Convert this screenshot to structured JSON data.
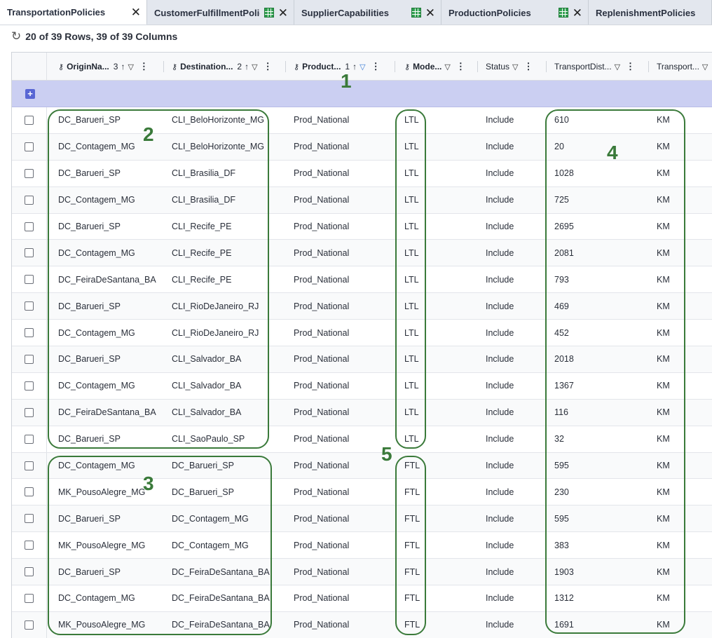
{
  "tabs": [
    {
      "label": "TransportationPolicies",
      "active": true,
      "has_icons": false
    },
    {
      "label": "CustomerFulfillmentPolicie",
      "active": false,
      "has_icons": true
    },
    {
      "label": "SupplierCapabilities",
      "active": false,
      "has_icons": true
    },
    {
      "label": "ProductionPolicies",
      "active": false,
      "has_icons": true
    },
    {
      "label": "ReplenishmentPolicies",
      "active": false,
      "has_icons": false
    }
  ],
  "row_summary": "20 of 39 Rows, 39 of 39 Columns",
  "columns": [
    {
      "label": "OriginNa...",
      "key": true,
      "sort": "3",
      "sort_arrow": "↑",
      "filter": "▽",
      "filter_active": false,
      "menu": "⋮",
      "bold": true
    },
    {
      "label": "Destination...",
      "key": true,
      "sort": "2",
      "sort_arrow": "↑",
      "filter": "▽",
      "filter_active": false,
      "menu": "⋮",
      "bold": true
    },
    {
      "label": "Product...",
      "key": true,
      "sort": "1",
      "sort_arrow": "↑",
      "filter": "▽",
      "filter_active": true,
      "menu": "⋮",
      "bold": true
    },
    {
      "label": "Mode...",
      "key": true,
      "sort": "",
      "sort_arrow": "",
      "filter": "▽",
      "filter_active": false,
      "menu": "⋮",
      "bold": true
    },
    {
      "label": "Status",
      "key": false,
      "sort": "",
      "sort_arrow": "",
      "filter": "▽",
      "filter_active": false,
      "menu": "⋮",
      "bold": false
    },
    {
      "label": "TransportDist...",
      "key": false,
      "sort": "",
      "sort_arrow": "",
      "filter": "▽",
      "filter_active": false,
      "menu": "⋮",
      "bold": false
    },
    {
      "label": "Transport...",
      "key": false,
      "sort": "",
      "sort_arrow": "",
      "filter": "▽",
      "filter_active": false,
      "menu": "",
      "bold": false
    }
  ],
  "rows": [
    [
      "DC_Barueri_SP",
      "CLI_BeloHorizonte_MG",
      "Prod_National",
      "LTL",
      "Include",
      "610",
      "KM"
    ],
    [
      "DC_Contagem_MG",
      "CLI_BeloHorizonte_MG",
      "Prod_National",
      "LTL",
      "Include",
      "20",
      "KM"
    ],
    [
      "DC_Barueri_SP",
      "CLI_Brasilia_DF",
      "Prod_National",
      "LTL",
      "Include",
      "1028",
      "KM"
    ],
    [
      "DC_Contagem_MG",
      "CLI_Brasilia_DF",
      "Prod_National",
      "LTL",
      "Include",
      "725",
      "KM"
    ],
    [
      "DC_Barueri_SP",
      "CLI_Recife_PE",
      "Prod_National",
      "LTL",
      "Include",
      "2695",
      "KM"
    ],
    [
      "DC_Contagem_MG",
      "CLI_Recife_PE",
      "Prod_National",
      "LTL",
      "Include",
      "2081",
      "KM"
    ],
    [
      "DC_FeiraDeSantana_BA",
      "CLI_Recife_PE",
      "Prod_National",
      "LTL",
      "Include",
      "793",
      "KM"
    ],
    [
      "DC_Barueri_SP",
      "CLI_RioDeJaneiro_RJ",
      "Prod_National",
      "LTL",
      "Include",
      "469",
      "KM"
    ],
    [
      "DC_Contagem_MG",
      "CLI_RioDeJaneiro_RJ",
      "Prod_National",
      "LTL",
      "Include",
      "452",
      "KM"
    ],
    [
      "DC_Barueri_SP",
      "CLI_Salvador_BA",
      "Prod_National",
      "LTL",
      "Include",
      "2018",
      "KM"
    ],
    [
      "DC_Contagem_MG",
      "CLI_Salvador_BA",
      "Prod_National",
      "LTL",
      "Include",
      "1367",
      "KM"
    ],
    [
      "DC_FeiraDeSantana_BA",
      "CLI_Salvador_BA",
      "Prod_National",
      "LTL",
      "Include",
      "116",
      "KM"
    ],
    [
      "DC_Barueri_SP",
      "CLI_SaoPaulo_SP",
      "Prod_National",
      "LTL",
      "Include",
      "32",
      "KM"
    ],
    [
      "DC_Contagem_MG",
      "DC_Barueri_SP",
      "Prod_National",
      "FTL",
      "Include",
      "595",
      "KM"
    ],
    [
      "MK_PousoAlegre_MG",
      "DC_Barueri_SP",
      "Prod_National",
      "FTL",
      "Include",
      "230",
      "KM"
    ],
    [
      "DC_Barueri_SP",
      "DC_Contagem_MG",
      "Prod_National",
      "FTL",
      "Include",
      "595",
      "KM"
    ],
    [
      "MK_PousoAlegre_MG",
      "DC_Contagem_MG",
      "Prod_National",
      "FTL",
      "Include",
      "383",
      "KM"
    ],
    [
      "DC_Barueri_SP",
      "DC_FeiraDeSantana_BA",
      "Prod_National",
      "FTL",
      "Include",
      "1903",
      "KM"
    ],
    [
      "DC_Contagem_MG",
      "DC_FeiraDeSantana_BA",
      "Prod_National",
      "FTL",
      "Include",
      "1312",
      "KM"
    ],
    [
      "MK_PousoAlegre_MG",
      "DC_FeiraDeSantana_BA",
      "Prod_National",
      "FTL",
      "Include",
      "1691",
      "KM"
    ]
  ],
  "annotations": [
    "1",
    "2",
    "3",
    "4",
    "5"
  ],
  "colors": {
    "annotation": "#3a7a3a",
    "add_row_band": "#cbcff2",
    "filter_active": "#3a7bd5",
    "grid_icon": "#2f9e4f"
  },
  "icons": {
    "refresh": "refresh-icon",
    "key": "key-icon",
    "grid": "grid-icon",
    "close": "close-icon",
    "add": "plus-icon"
  }
}
